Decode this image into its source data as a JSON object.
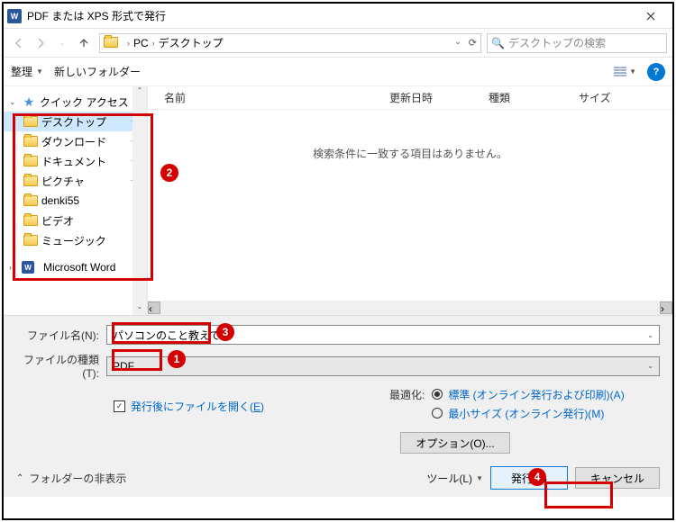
{
  "title": "PDF または XPS 形式で発行",
  "path": {
    "segs": [
      "PC",
      "デスクトップ"
    ]
  },
  "search": {
    "placeholder": "デスクトップの検索"
  },
  "toolbar": {
    "organize": "整理",
    "new_folder": "新しいフォルダー"
  },
  "columns": {
    "name": "名前",
    "date": "更新日時",
    "type": "種類",
    "size": "サイズ"
  },
  "empty_message": "検索条件に一致する項目はありません。",
  "tree": {
    "quick_access": "クイック アクセス",
    "items": [
      {
        "label": "デスクトップ",
        "pinned": true
      },
      {
        "label": "ダウンロード",
        "pinned": true
      },
      {
        "label": "ドキュメント",
        "pinned": true
      },
      {
        "label": "ピクチャ",
        "pinned": true
      },
      {
        "label": "denki55",
        "pinned": false
      },
      {
        "label": "ビデオ",
        "pinned": false
      },
      {
        "label": "ミュージック",
        "pinned": false
      }
    ],
    "word": "Microsoft Word"
  },
  "bottom": {
    "filename_label": "ファイル名(N):",
    "filename_value": "パソコンのこと教えて",
    "filetype_label": "ファイルの種類(T):",
    "filetype_value": "PDF",
    "open_after": "発行後にファイルを開く(E)",
    "optimize_label": "最適化:",
    "opt_standard": "標準 (オンライン発行および印刷)(A)",
    "opt_min": "最小サイズ (オンライン発行)(M)",
    "options_btn": "オプション(O)...",
    "hide_folders": "フォルダーの非表示",
    "tools": "ツール(L)",
    "publish": "発行(S)",
    "cancel": "キャンセル"
  },
  "badges": {
    "b1": "1",
    "b2": "2",
    "b3": "3",
    "b4": "4"
  }
}
